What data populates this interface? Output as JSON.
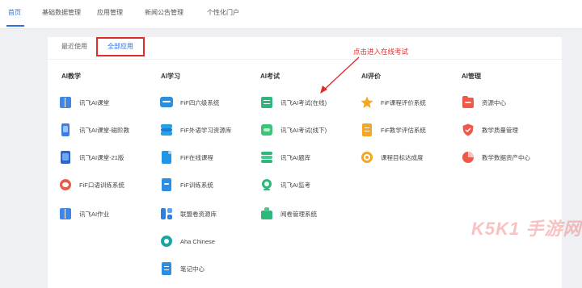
{
  "topnav": {
    "tabs": [
      {
        "label": "首页",
        "active": true
      },
      {
        "label": "基础数据管理",
        "active": false
      },
      {
        "label": "应用管理",
        "active": false
      },
      {
        "label": "新闻公告管理",
        "active": false
      },
      {
        "label": "个性化门户",
        "active": false
      }
    ]
  },
  "subtabs": {
    "recent": "最近使用",
    "all": "全部应用"
  },
  "annotation": "点击进入在线考试",
  "columns": [
    {
      "title": "AI教学",
      "items": [
        {
          "label": "讯飞AI课堂",
          "icon": "book-icon"
        },
        {
          "label": "讯飞AI课堂-磁阶教",
          "icon": "mobile-classroom-icon"
        },
        {
          "label": "讯飞AI课堂-21版",
          "icon": "tablet-classroom-icon"
        },
        {
          "label": "FiF口语训练系统",
          "icon": "speech-training-icon"
        },
        {
          "label": "讯飞AI作业",
          "icon": "homework-book-icon"
        }
      ]
    },
    {
      "title": "AI学习",
      "items": [
        {
          "label": "FiF四六级系统",
          "icon": "cet-chat-icon"
        },
        {
          "label": "FiF外语学习资源库",
          "icon": "s-resource-icon"
        },
        {
          "label": "FiF在线课程",
          "icon": "online-course-icon"
        },
        {
          "label": "FiF训练系统",
          "icon": "training-doc-icon"
        },
        {
          "label": "联盟卷资源库",
          "icon": "resource-grid-icon"
        },
        {
          "label": "Aha Chinese",
          "icon": "aha-chinese-icon"
        },
        {
          "label": "笔记中心",
          "icon": "notes-icon"
        }
      ]
    },
    {
      "title": "AI考试",
      "items": [
        {
          "label": "讯飞AI考试(在线)",
          "icon": "online-exam-icon"
        },
        {
          "label": "讯飞AI考试(线下)",
          "icon": "app-exam-icon"
        },
        {
          "label": "讯飞AI题库",
          "icon": "question-bank-icon"
        },
        {
          "label": "讯飞AI监考",
          "icon": "proctor-camera-icon"
        },
        {
          "label": "阅卷管理系统",
          "icon": "grading-icon"
        }
      ]
    },
    {
      "title": "AI评价",
      "items": [
        {
          "label": "FiF课程评价系统",
          "icon": "star-icon"
        },
        {
          "label": "FiF教学评估系统",
          "icon": "evaluation-doc-icon"
        },
        {
          "label": "课程目标达成度",
          "icon": "target-icon"
        }
      ]
    },
    {
      "title": "AI管理",
      "items": [
        {
          "label": "资源中心",
          "icon": "resource-center-icon"
        },
        {
          "label": "教学质量管理",
          "icon": "quality-shield-icon"
        },
        {
          "label": "教学数据资产中心",
          "icon": "data-pie-icon"
        }
      ]
    }
  ],
  "watermark": "K5K1 手游网",
  "colors": {
    "accent": "#2f6fe0",
    "annotation_red": "#e22b2b"
  }
}
